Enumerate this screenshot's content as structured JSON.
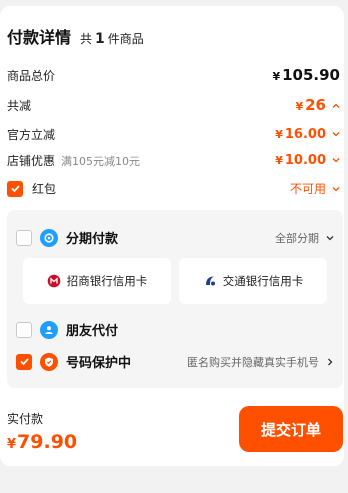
{
  "header": {
    "title": "付款详情",
    "count_prefix": "共",
    "count": "1",
    "count_suffix": "件商品"
  },
  "summary": {
    "total": {
      "label": "商品总价",
      "currency": "¥",
      "value": "105.90"
    },
    "discount": {
      "label": "共减",
      "currency": "¥",
      "value": "26"
    },
    "official": {
      "label": "官方立减",
      "currency": "¥",
      "value": "16.00"
    },
    "store": {
      "label": "店铺优惠",
      "note": "满105元减10元",
      "currency": "¥",
      "value": "10.00"
    },
    "redpacket": {
      "label": "红包",
      "status": "不可用"
    }
  },
  "payment": {
    "installment": {
      "label": "分期付款",
      "option": "全部分期"
    },
    "banks": [
      {
        "name": "招商银行信用卡"
      },
      {
        "name": "交通银行信用卡"
      }
    ],
    "friend": {
      "label": "朋友代付"
    },
    "privacy": {
      "label": "号码保护中",
      "desc": "匿名购买并隐藏真实手机号"
    }
  },
  "footer": {
    "label": "实付款",
    "currency": "¥",
    "amount": "79.90",
    "submit": "提交订单"
  },
  "colors": {
    "accent": "#ff5000",
    "alipay_blue": "#1e9fff",
    "cmb_red": "#c8102e",
    "bocom_navy": "#1f3f8a"
  }
}
